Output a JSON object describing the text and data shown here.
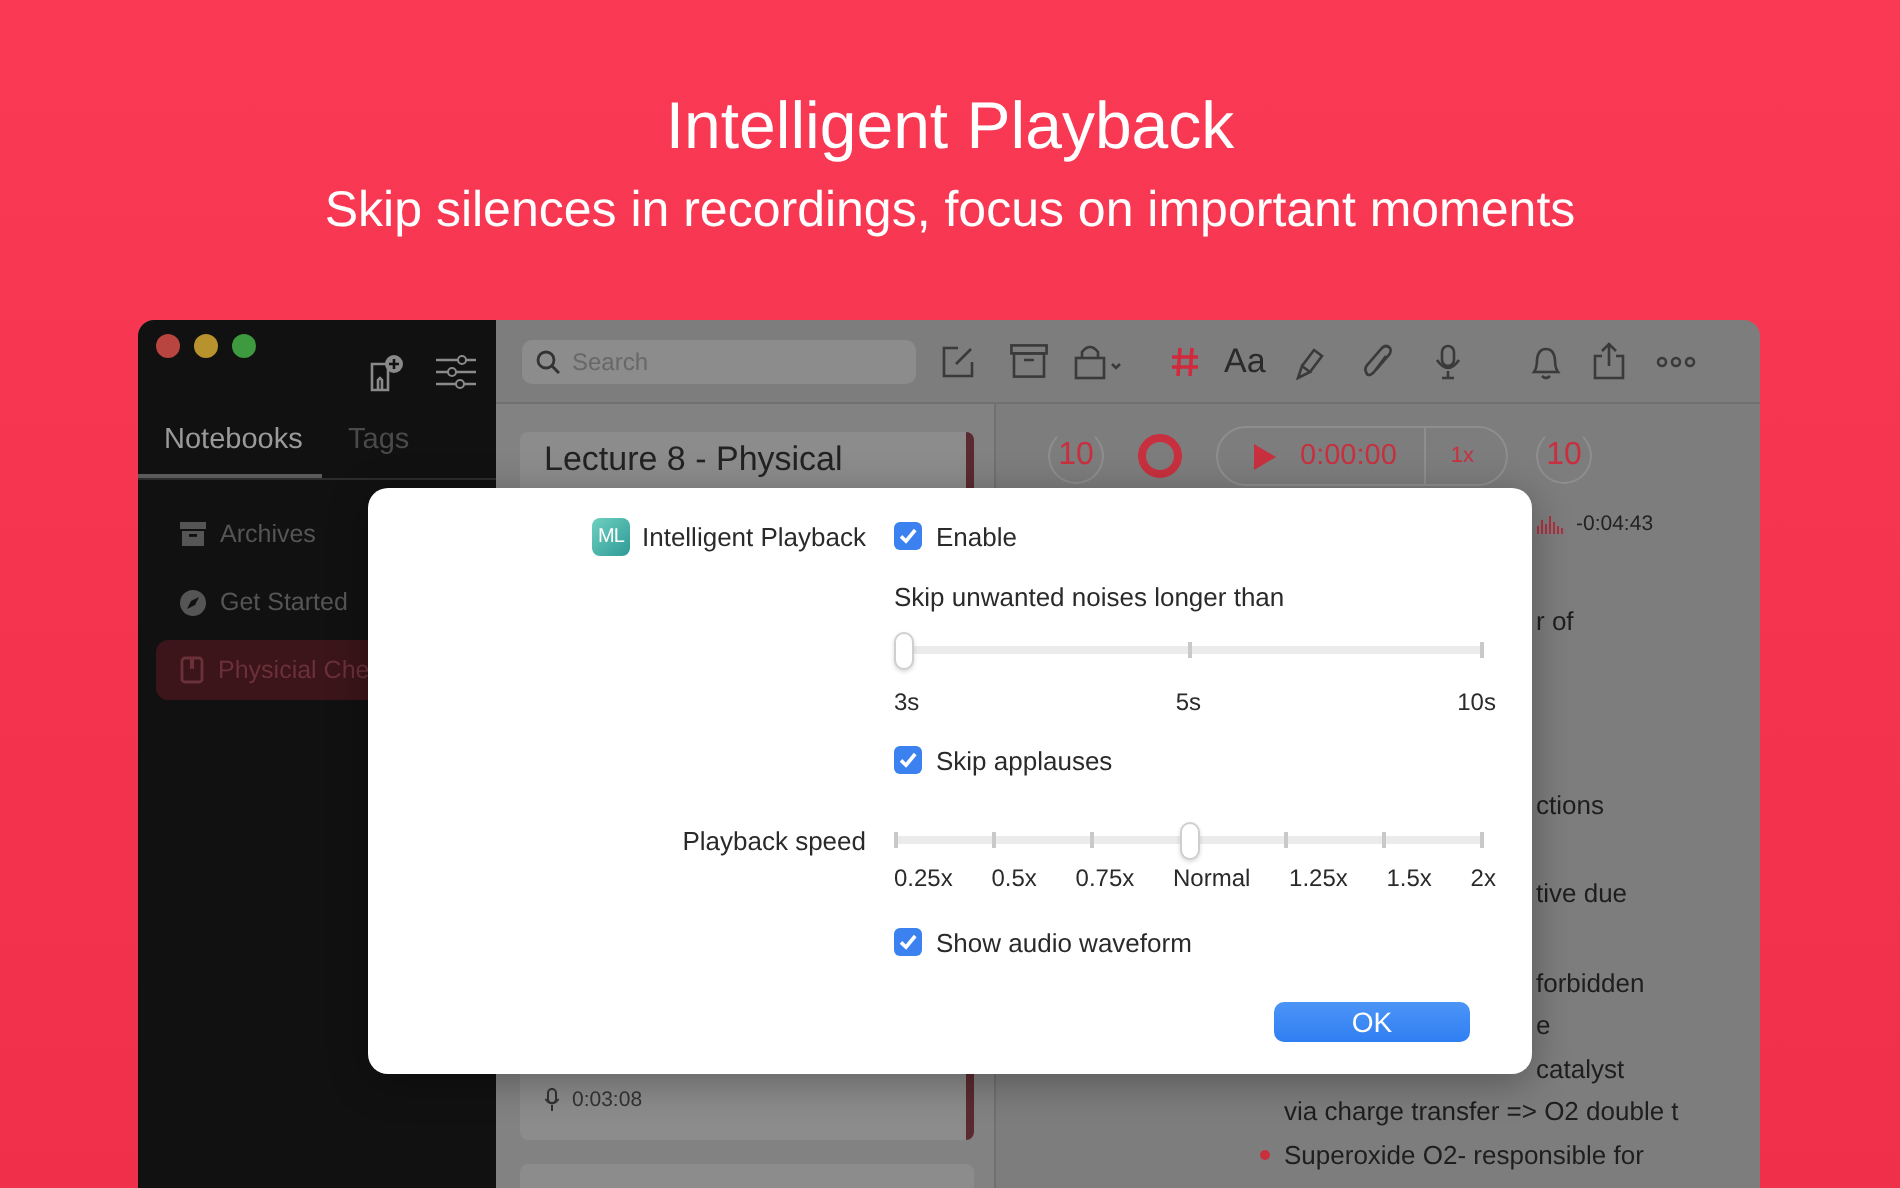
{
  "header": {
    "title": "Intelligent Playback",
    "subtitle": "Skip silences in recordings, focus on important moments"
  },
  "sidebar": {
    "tabs": [
      {
        "label": "Notebooks",
        "selected": true
      },
      {
        "label": "Tags",
        "selected": false
      }
    ],
    "items": [
      {
        "label": "Archives",
        "selected": false
      },
      {
        "label": "Get Started",
        "selected": false
      },
      {
        "label": "Physicial Che",
        "selected": true
      }
    ]
  },
  "toolbar": {
    "search": {
      "placeholder": "Search"
    },
    "format_label": "Aa"
  },
  "note_list": {
    "cards": [
      {
        "title": "Lecture 8 - Physical",
        "duration": "0:03:08"
      }
    ]
  },
  "player": {
    "skip_back": "10",
    "elapsed": "0:00:00",
    "speed": "1x",
    "skip_forward": "10",
    "remaining": "-0:04:43"
  },
  "editor": {
    "lines": [
      {
        "kind": "fragment",
        "text": "r of"
      },
      {
        "kind": "fragment",
        "text": "ctions"
      },
      {
        "kind": "fragment",
        "text": "tive due"
      },
      {
        "kind": "fragment",
        "text": "forbidden"
      },
      {
        "kind": "fragment",
        "text": "e"
      },
      {
        "kind": "fragment",
        "text": "catalyst"
      },
      {
        "kind": "continuation",
        "text": "via charge transfer => O2 double t"
      },
      {
        "kind": "bullet",
        "text": "Superoxide O2- responsible for"
      }
    ]
  },
  "dialog": {
    "feature_badge": "ML",
    "feature_label": "Intelligent Playback",
    "enable": {
      "label": "Enable",
      "checked": true
    },
    "noise_prompt": "Skip unwanted noises longer than",
    "noise_slider": {
      "level": 0,
      "ticks": [
        "3s",
        "5s",
        "10s"
      ]
    },
    "applause": {
      "label": "Skip applauses",
      "checked": true
    },
    "speed_label": "Playback speed",
    "speed_slider": {
      "level": 0.5,
      "ticks": [
        "0.25x",
        "0.5x",
        "0.75x",
        "Normal",
        "1.25x",
        "1.5x",
        "2x"
      ]
    },
    "waveform": {
      "label": "Show audio waveform",
      "checked": true
    },
    "ok_button": "OK"
  }
}
